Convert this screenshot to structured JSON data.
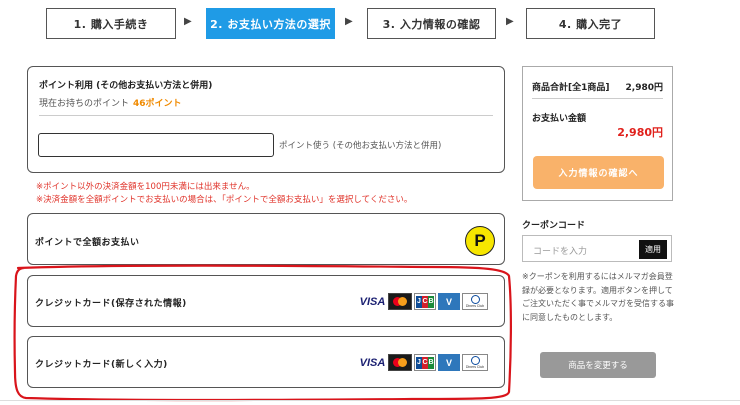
{
  "steps": [
    {
      "label": "1. 購入手続き"
    },
    {
      "label": "2. お支払い方法の選択"
    },
    {
      "label": "3. 入力情報の確認"
    },
    {
      "label": "4. 購入完了"
    }
  ],
  "step_arrow": "▶",
  "points": {
    "title": "ポイント利用 (その他お支払い方法と併用)",
    "current_label": "現在お持ちのポイント",
    "current_value": "46ポイント",
    "input_value": "",
    "input_suffix": "ポイント使う (その他お支払い方法と併用)"
  },
  "notices": [
    "※ポイント以外の決済金額を100円未満には出来ません。",
    "※決済金額を全額ポイントでお支払いの場合は、「ポイントで全額お支払い」を選択してください。"
  ],
  "payment_options": {
    "full_points": {
      "label": "ポイントで全額お支払い",
      "icon_text": "P"
    },
    "saved_card": {
      "label": "クレジットカード(保存された情報)"
    },
    "new_card": {
      "label": "クレジットカード(新しく入力)"
    }
  },
  "card_brands": {
    "visa": "VISA",
    "amex": "V",
    "diners": "Diners Club"
  },
  "summary": {
    "subtotal_label": "商品合計[全1商品]",
    "subtotal_value": "2,980円",
    "total_label": "お支払い金額",
    "total_value": "2,980円",
    "confirm_button": "入力情報の確認へ"
  },
  "coupon": {
    "title": "クーポンコード",
    "placeholder": "コードを入力",
    "apply_button": "適用",
    "note": "※クーポンを利用するにはメルマガ会員登録が必要となります。適用ボタンを押してご注文いただく事でメルマガを受信する事に同意したものとします。"
  },
  "change_button": "商品を変更する",
  "colors": {
    "active_step": "#1f9be6",
    "points_accent": "#f08a00",
    "notice_red": "#e0342b",
    "total_red": "#e0201b",
    "confirm_button": "#f9b26a",
    "annotation_red": "#d9141b"
  }
}
